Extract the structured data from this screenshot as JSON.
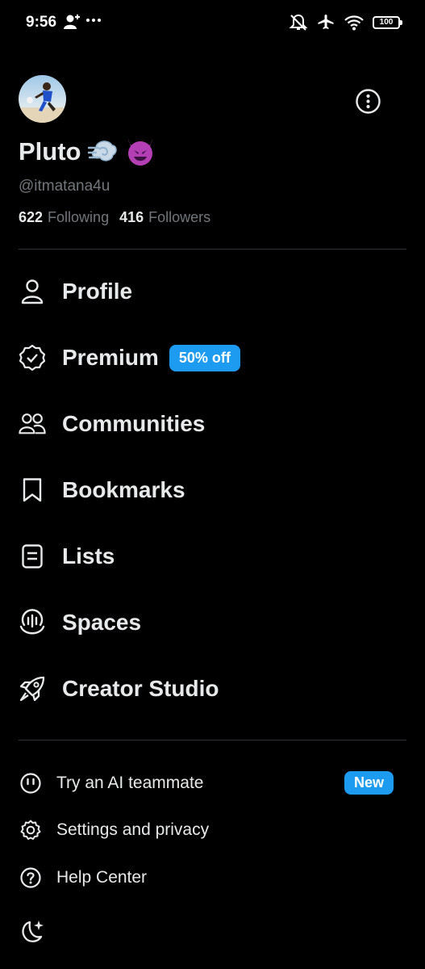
{
  "status_bar": {
    "time": "9:56",
    "battery": "100",
    "icons": [
      "add-user-icon",
      "more-dots-icon",
      "mute-icon",
      "airplane-icon",
      "wifi-icon",
      "battery-icon"
    ]
  },
  "profile": {
    "display_name": "Pluto",
    "name_emojis": "💨😈",
    "handle": "@itmatana4u",
    "following_count": "622",
    "following_label": "Following",
    "followers_count": "416",
    "followers_label": "Followers"
  },
  "nav": {
    "profile": "Profile",
    "premium": "Premium",
    "premium_badge": "50% off",
    "communities": "Communities",
    "bookmarks": "Bookmarks",
    "lists": "Lists",
    "spaces": "Spaces",
    "creator_studio": "Creator Studio"
  },
  "secondary": {
    "ai_teammate": "Try an AI teammate",
    "ai_badge": "New",
    "settings": "Settings and privacy",
    "help": "Help Center"
  },
  "colors": {
    "background": "#000000",
    "text": "#e7e9ea",
    "muted": "#71767b",
    "accent": "#1d9bf0",
    "divider": "#2f3336"
  }
}
